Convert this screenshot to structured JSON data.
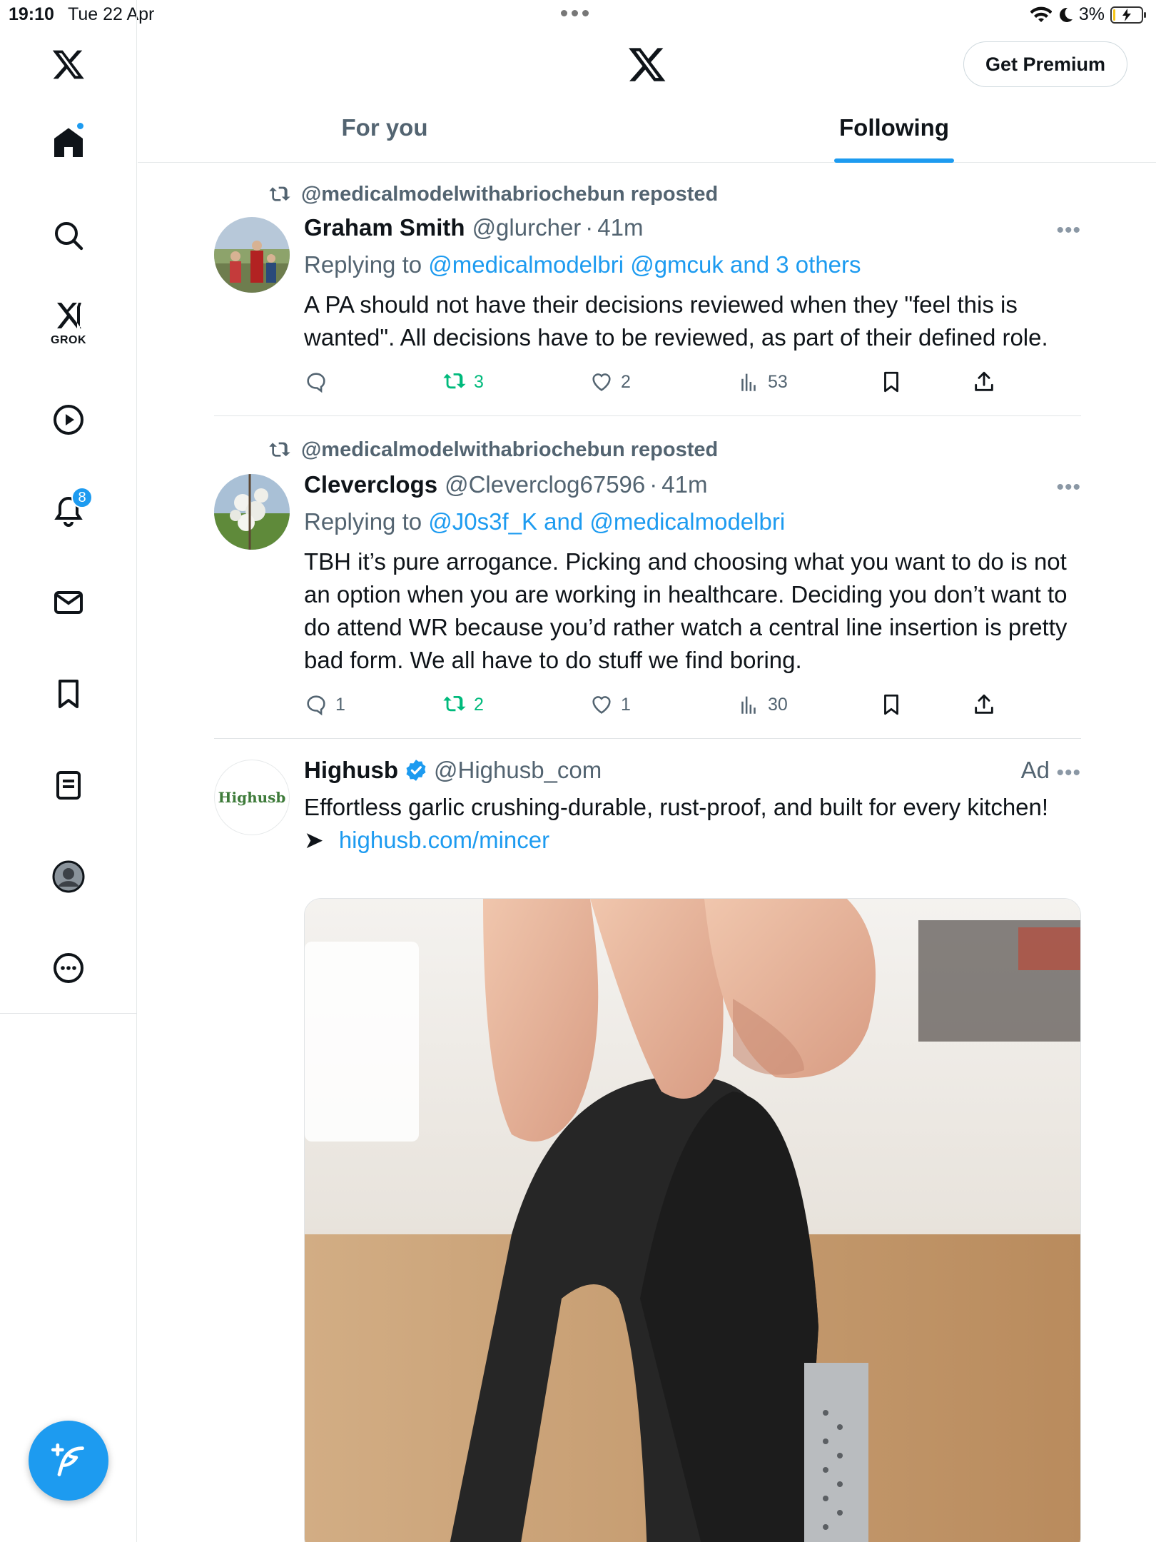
{
  "status_bar": {
    "time": "19:10",
    "date": "Tue 22 Apr",
    "battery": "3%"
  },
  "sidebar": {
    "grok_label": "GROK",
    "notifications_count": "8"
  },
  "header": {
    "premium_button": "Get Premium",
    "tabs": [
      {
        "label": "For you",
        "active": false
      },
      {
        "label": "Following",
        "active": true
      }
    ]
  },
  "posts": [
    {
      "repost_by": "@medicalmodelwithabriochebun reposted",
      "name": "Graham Smith",
      "handle": "@glurcher",
      "time": "41m",
      "replying_prefix": "Replying to ",
      "replying_to": "@medicalmodelbri @gmcuk and 3 others",
      "text": "A PA should not have their decisions reviewed when they \"feel this is wanted\". All decisions have to be reviewed, as part of their defined role.",
      "replies": "",
      "reposts": "3",
      "likes": "2",
      "views": "53"
    },
    {
      "repost_by": "@medicalmodelwithabriochebun reposted",
      "name": "Cleverclogs",
      "handle": "@Cleverclog67596",
      "time": "41m",
      "replying_prefix": "Replying to ",
      "replying_to": "@J0s3f_K and @medicalmodelbri",
      "text": "TBH it’s pure arrogance. Picking and choosing what you want to do is not an option when you are working in healthcare. Deciding you don’t want to do attend WR because you’d rather watch a central line insertion is pretty bad form. We all have to do stuff we find boring.",
      "replies": "1",
      "reposts": "2",
      "likes": "1",
      "views": "30"
    }
  ],
  "ad": {
    "name": "Highusb",
    "handle": "@Highusb_com",
    "ad_label": "Ad",
    "avatar_text": "Highusb",
    "text": "Effortless garlic crushing-durable, rust-proof, and built for every kitchen!",
    "arrow": "➤",
    "link": "highusb.com/mincer"
  },
  "colors": {
    "accent": "#1d9bf0",
    "secondary_text": "#536471",
    "repost_green": "#00ba7c"
  }
}
